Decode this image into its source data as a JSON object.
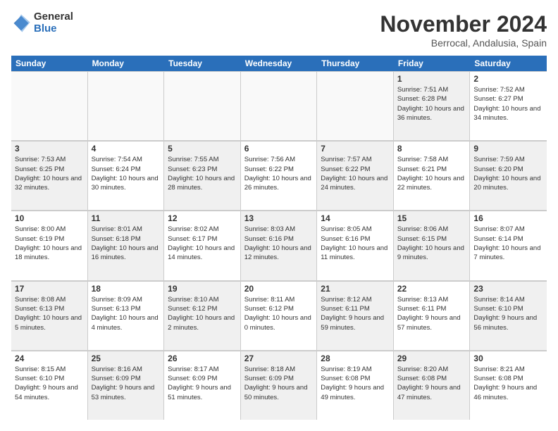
{
  "logo": {
    "general": "General",
    "blue": "Blue"
  },
  "title": "November 2024",
  "location": "Berrocal, Andalusia, Spain",
  "days_of_week": [
    "Sunday",
    "Monday",
    "Tuesday",
    "Wednesday",
    "Thursday",
    "Friday",
    "Saturday"
  ],
  "weeks": [
    [
      {
        "day": "",
        "info": "",
        "empty": true
      },
      {
        "day": "",
        "info": "",
        "empty": true
      },
      {
        "day": "",
        "info": "",
        "empty": true
      },
      {
        "day": "",
        "info": "",
        "empty": true
      },
      {
        "day": "",
        "info": "",
        "empty": true
      },
      {
        "day": "1",
        "info": "Sunrise: 7:51 AM\nSunset: 6:28 PM\nDaylight: 10 hours and 36 minutes.",
        "shaded": true
      },
      {
        "day": "2",
        "info": "Sunrise: 7:52 AM\nSunset: 6:27 PM\nDaylight: 10 hours and 34 minutes.",
        "shaded": false
      }
    ],
    [
      {
        "day": "3",
        "info": "Sunrise: 7:53 AM\nSunset: 6:25 PM\nDaylight: 10 hours and 32 minutes.",
        "shaded": true
      },
      {
        "day": "4",
        "info": "Sunrise: 7:54 AM\nSunset: 6:24 PM\nDaylight: 10 hours and 30 minutes.",
        "shaded": false
      },
      {
        "day": "5",
        "info": "Sunrise: 7:55 AM\nSunset: 6:23 PM\nDaylight: 10 hours and 28 minutes.",
        "shaded": true
      },
      {
        "day": "6",
        "info": "Sunrise: 7:56 AM\nSunset: 6:22 PM\nDaylight: 10 hours and 26 minutes.",
        "shaded": false
      },
      {
        "day": "7",
        "info": "Sunrise: 7:57 AM\nSunset: 6:22 PM\nDaylight: 10 hours and 24 minutes.",
        "shaded": true
      },
      {
        "day": "8",
        "info": "Sunrise: 7:58 AM\nSunset: 6:21 PM\nDaylight: 10 hours and 22 minutes.",
        "shaded": false
      },
      {
        "day": "9",
        "info": "Sunrise: 7:59 AM\nSunset: 6:20 PM\nDaylight: 10 hours and 20 minutes.",
        "shaded": true
      }
    ],
    [
      {
        "day": "10",
        "info": "Sunrise: 8:00 AM\nSunset: 6:19 PM\nDaylight: 10 hours and 18 minutes.",
        "shaded": false
      },
      {
        "day": "11",
        "info": "Sunrise: 8:01 AM\nSunset: 6:18 PM\nDaylight: 10 hours and 16 minutes.",
        "shaded": true
      },
      {
        "day": "12",
        "info": "Sunrise: 8:02 AM\nSunset: 6:17 PM\nDaylight: 10 hours and 14 minutes.",
        "shaded": false
      },
      {
        "day": "13",
        "info": "Sunrise: 8:03 AM\nSunset: 6:16 PM\nDaylight: 10 hours and 12 minutes.",
        "shaded": true
      },
      {
        "day": "14",
        "info": "Sunrise: 8:05 AM\nSunset: 6:16 PM\nDaylight: 10 hours and 11 minutes.",
        "shaded": false
      },
      {
        "day": "15",
        "info": "Sunrise: 8:06 AM\nSunset: 6:15 PM\nDaylight: 10 hours and 9 minutes.",
        "shaded": true
      },
      {
        "day": "16",
        "info": "Sunrise: 8:07 AM\nSunset: 6:14 PM\nDaylight: 10 hours and 7 minutes.",
        "shaded": false
      }
    ],
    [
      {
        "day": "17",
        "info": "Sunrise: 8:08 AM\nSunset: 6:13 PM\nDaylight: 10 hours and 5 minutes.",
        "shaded": true
      },
      {
        "day": "18",
        "info": "Sunrise: 8:09 AM\nSunset: 6:13 PM\nDaylight: 10 hours and 4 minutes.",
        "shaded": false
      },
      {
        "day": "19",
        "info": "Sunrise: 8:10 AM\nSunset: 6:12 PM\nDaylight: 10 hours and 2 minutes.",
        "shaded": true
      },
      {
        "day": "20",
        "info": "Sunrise: 8:11 AM\nSunset: 6:12 PM\nDaylight: 10 hours and 0 minutes.",
        "shaded": false
      },
      {
        "day": "21",
        "info": "Sunrise: 8:12 AM\nSunset: 6:11 PM\nDaylight: 9 hours and 59 minutes.",
        "shaded": true
      },
      {
        "day": "22",
        "info": "Sunrise: 8:13 AM\nSunset: 6:11 PM\nDaylight: 9 hours and 57 minutes.",
        "shaded": false
      },
      {
        "day": "23",
        "info": "Sunrise: 8:14 AM\nSunset: 6:10 PM\nDaylight: 9 hours and 56 minutes.",
        "shaded": true
      }
    ],
    [
      {
        "day": "24",
        "info": "Sunrise: 8:15 AM\nSunset: 6:10 PM\nDaylight: 9 hours and 54 minutes.",
        "shaded": false
      },
      {
        "day": "25",
        "info": "Sunrise: 8:16 AM\nSunset: 6:09 PM\nDaylight: 9 hours and 53 minutes.",
        "shaded": true
      },
      {
        "day": "26",
        "info": "Sunrise: 8:17 AM\nSunset: 6:09 PM\nDaylight: 9 hours and 51 minutes.",
        "shaded": false
      },
      {
        "day": "27",
        "info": "Sunrise: 8:18 AM\nSunset: 6:09 PM\nDaylight: 9 hours and 50 minutes.",
        "shaded": true
      },
      {
        "day": "28",
        "info": "Sunrise: 8:19 AM\nSunset: 6:08 PM\nDaylight: 9 hours and 49 minutes.",
        "shaded": false
      },
      {
        "day": "29",
        "info": "Sunrise: 8:20 AM\nSunset: 6:08 PM\nDaylight: 9 hours and 47 minutes.",
        "shaded": true
      },
      {
        "day": "30",
        "info": "Sunrise: 8:21 AM\nSunset: 6:08 PM\nDaylight: 9 hours and 46 minutes.",
        "shaded": false
      }
    ]
  ]
}
